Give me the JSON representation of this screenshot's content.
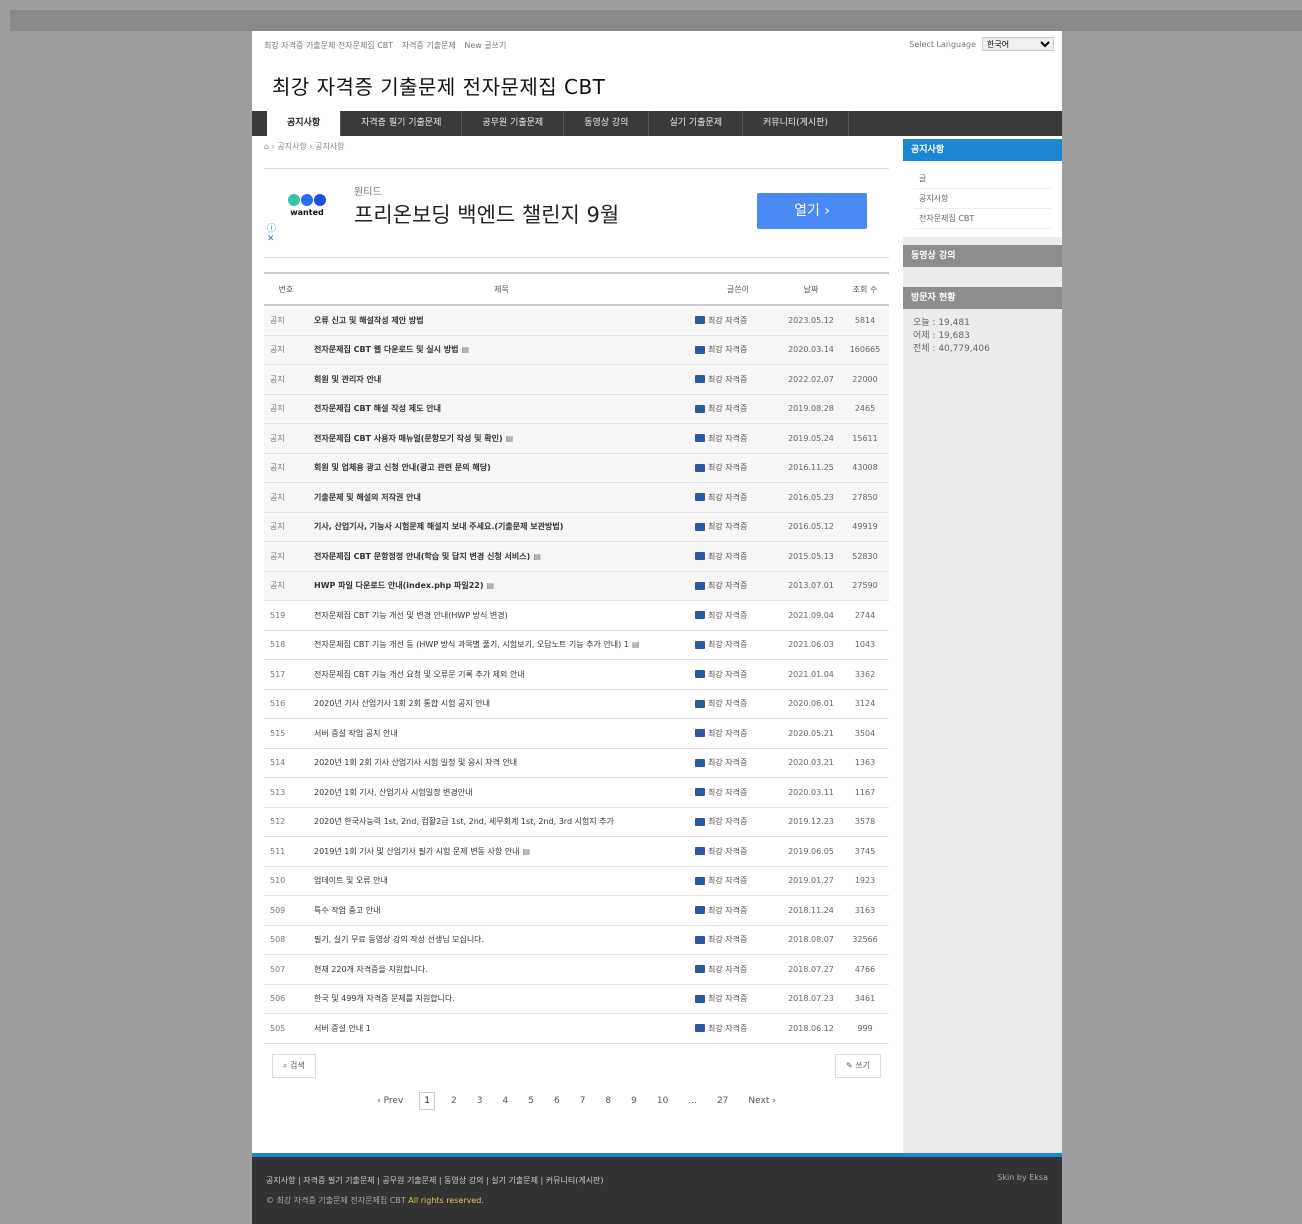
{
  "topbar": {
    "links": [
      "최강 자격증 기출문제 전자문제집 CBT",
      "자격증 기출문제",
      "New 글쓰기"
    ],
    "language_label": "Select Language",
    "language_value": "한국어"
  },
  "site_title": "최강 자격증 기출문제 전자문제집 CBT",
  "gnb": {
    "items": [
      "공지사항",
      "자격증 필기 기출문제",
      "공무원 기출문제",
      "동영상 강의",
      "실기 기출문제",
      "커뮤니티(게시판)"
    ]
  },
  "breadcrumb": {
    "home": "⌂",
    "path": "› 공지사항 › 공지사항"
  },
  "ad": {
    "logo": "wanted",
    "brand": "원티드",
    "headline": "프리온보딩 백엔드 챌린지 9월",
    "cta": "열기 ›",
    "adchoice": "ⓘ\n✕"
  },
  "board": {
    "headers": {
      "no": "번호",
      "title": "제목",
      "author": "글쓴이",
      "date": "날짜",
      "views": "조회 수"
    },
    "rows": [
      {
        "no": "공지",
        "title": "오류 신고 및 해설작성 제안 방법",
        "author": "최강 자격증",
        "date": "2023.05.12",
        "views": "5814",
        "notice": true,
        "file": false
      },
      {
        "no": "공지",
        "title": "전자문제집 CBT 웹 다운로드 및 실시 방법",
        "author": "최강 자격증",
        "date": "2020.03.14",
        "views": "160665",
        "notice": true,
        "file": true
      },
      {
        "no": "공지",
        "title": "회원 및 관리자 안내",
        "author": "최강 자격증",
        "date": "2022.02.07",
        "views": "22000",
        "notice": true,
        "file": false
      },
      {
        "no": "공지",
        "title": "전자문제집 CBT 해설 작성 제도 안내",
        "author": "최강 자격증",
        "date": "2019.08.28",
        "views": "2465",
        "notice": true,
        "file": false
      },
      {
        "no": "공지",
        "title": "전자문제집 CBT 사용자 매뉴얼(문항모기 작성 및 확인)",
        "author": "최강 자격증",
        "date": "2019.05.24",
        "views": "15611",
        "notice": true,
        "file": true
      },
      {
        "no": "공지",
        "title": "회원 및 업체용 광고 신청 안내(광고 관련 문의 해당)",
        "author": "최강 자격증",
        "date": "2016.11.25",
        "views": "43008",
        "notice": true,
        "file": false
      },
      {
        "no": "공지",
        "title": "기출문제 및 해설의 저작권 안내",
        "author": "최강 자격증",
        "date": "2016.05.23",
        "views": "27850",
        "notice": true,
        "file": false
      },
      {
        "no": "공지",
        "title": "기사, 산업기사, 기능사 시험문제 해설지 보내 주세요.(기출문제 보관방법)",
        "author": "최강 자격증",
        "date": "2016.05.12",
        "views": "49919",
        "notice": true,
        "file": false
      },
      {
        "no": "공지",
        "title": "전자문제집 CBT 문항정정 안내(학습 및 답지 변경 신청 서비스)",
        "author": "최강 자격증",
        "date": "2015.05.13",
        "views": "52830",
        "notice": true,
        "file": true
      },
      {
        "no": "공지",
        "title": "HWP 파일 다운로드 안내(index.php 파일22)",
        "author": "최강 자격증",
        "date": "2013.07.01",
        "views": "27590",
        "notice": true,
        "file": true
      },
      {
        "no": "519",
        "title": "전자문제집 CBT 기능 개선 및 변경 안내(HWP 방식 변경)",
        "author": "최강 자격증",
        "date": "2021.09.04",
        "views": "2744",
        "notice": false,
        "file": false
      },
      {
        "no": "518",
        "title": "전자문제집 CBT 기능 개선 등 (HWP 방식 과목별 풀기, 시험보기, 오답노트 기능 추가 안내) 1",
        "author": "최강 자격증",
        "date": "2021.06.03",
        "views": "1043",
        "notice": false,
        "file": true
      },
      {
        "no": "517",
        "title": "전자문제집 CBT 기능 개선 요청 및 오류문 기록 추가 제외 안내",
        "author": "최강 자격증",
        "date": "2021.01.04",
        "views": "3362",
        "notice": false,
        "file": false
      },
      {
        "no": "516",
        "title": "2020년 기사 산업기사 1회 2회 통합 시험 공지 안내",
        "author": "최강 자격증",
        "date": "2020.06.01",
        "views": "3124",
        "notice": false,
        "file": false
      },
      {
        "no": "515",
        "title": "서버 증설 작업 공지 안내",
        "author": "최강 자격증",
        "date": "2020.05.21",
        "views": "3504",
        "notice": false,
        "file": false
      },
      {
        "no": "514",
        "title": "2020년 1회 2회 기사 산업기사 시험 일정 및 응시 자격 안내",
        "author": "최강 자격증",
        "date": "2020.03.21",
        "views": "1363",
        "notice": false,
        "file": false
      },
      {
        "no": "513",
        "title": "2020년 1회 기사, 산업기사 시험일정 변경안내",
        "author": "최강 자격증",
        "date": "2020.03.11",
        "views": "1167",
        "notice": false,
        "file": false
      },
      {
        "no": "512",
        "title": "2020년 한국사능력 1st, 2nd, 컴활2급 1st, 2nd, 세무회계 1st, 2nd, 3rd 시험지 추가",
        "author": "최강 자격증",
        "date": "2019.12.23",
        "views": "3578",
        "notice": false,
        "file": false
      },
      {
        "no": "511",
        "title": "2019년 1회 기사 및 산업기사 필기 시험 문제 변동 사항 안내",
        "author": "최강 자격증",
        "date": "2019.06.05",
        "views": "3745",
        "notice": false,
        "file": true
      },
      {
        "no": "510",
        "title": "업데이트 및 오류 안내",
        "author": "최강 자격증",
        "date": "2019.01.27",
        "views": "1923",
        "notice": false,
        "file": false
      },
      {
        "no": "509",
        "title": "특수 작업 중고 안내",
        "author": "최강 자격증",
        "date": "2018.11.24",
        "views": "3163",
        "notice": false,
        "file": false
      },
      {
        "no": "508",
        "title": "필기, 실기 무료 동영상 강의 작성 선생님 모십니다.",
        "author": "최강 자격증",
        "date": "2018.08.07",
        "views": "32566",
        "notice": false,
        "file": false
      },
      {
        "no": "507",
        "title": "현재 220개 자격증을 지원합니다.",
        "author": "최강 자격증",
        "date": "2018.07.27",
        "views": "4766",
        "notice": false,
        "file": false
      },
      {
        "no": "506",
        "title": "한국 및 499개 자격증 문제를 지원합니다.",
        "author": "최강 자격증",
        "date": "2018.07.23",
        "views": "3461",
        "notice": false,
        "file": false
      },
      {
        "no": "505",
        "title": "서버 증설 안내 1",
        "author": "최강 자격증",
        "date": "2018.06.12",
        "views": "999",
        "notice": false,
        "file": false
      }
    ]
  },
  "actions": {
    "search": "⌕ 검색",
    "write": "✎ 쓰기"
  },
  "pagination": {
    "prev": "‹ Prev",
    "pages": [
      "1",
      "2",
      "3",
      "4",
      "5",
      "6",
      "7",
      "8",
      "9",
      "10",
      "...",
      "27"
    ],
    "next": "Next ›"
  },
  "sidebar": {
    "notice_title": "공지사항",
    "notice_items": [
      "글",
      "공지사항",
      "전자문제집 CBT"
    ],
    "video_title": "동영상 강의",
    "visitor_title": "방문자 현황",
    "stats": {
      "today": "오늘 : 19,481",
      "yesterday": "어제 : 19,683",
      "total": "전체 : 40,779,406"
    }
  },
  "footer": {
    "links": "공지사항 | 자격증 필기 기출문제 | 공무원 기출문제 | 동영상 강의 | 실기 기출문제 | 커뮤니티(게시판)",
    "copy_prefix": "© 최강 자격증 기출문제 전자문제집 CBT",
    "copy_highlight": "All rights reserved.",
    "credit": "Skin by Eksa"
  },
  "colors": {
    "accent": "#1d86d4",
    "nav_bg": "#3a3a3a",
    "cta": "#4a8af4"
  }
}
